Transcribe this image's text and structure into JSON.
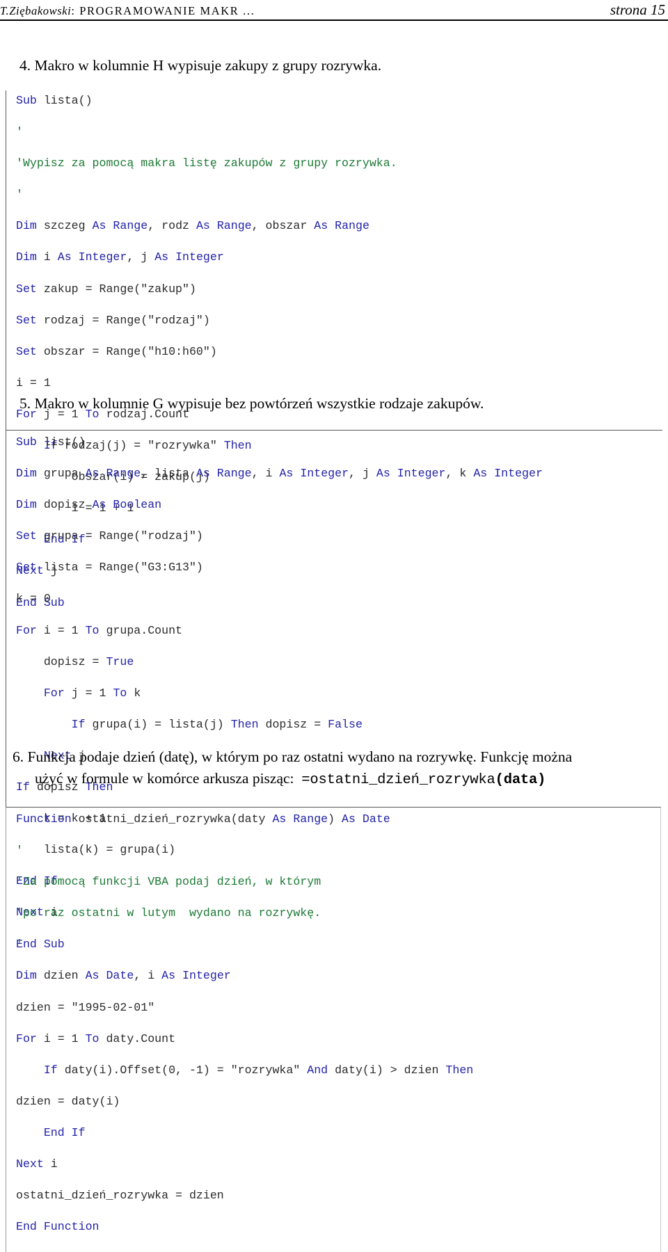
{
  "header": {
    "author": "T.Ziębakowski",
    "title": ": PROGRAMOWANIE MAKR ...",
    "page_label": "strona 15"
  },
  "tasks": [
    {
      "id": "task-4",
      "text": "4. Makro w kolumnie H wypisuje zakupy z grupy rozrywka."
    },
    {
      "id": "task-5",
      "text": "5. Makro w kolumnie G wypisuje bez powtórzeń wszystkie rodzaje zakupów."
    },
    {
      "id": "task-6",
      "line1": "6. Funkcja podaje dzień (datę), w którym po raz ostatni wydano na rozrywkę. Funkcję można",
      "line2_prefix": "użyć w formule w komórce arkusza pisząc:",
      "line2_formula_plain": "=ostatni_dzień_rozrywka",
      "line2_formula_bold": "(data)"
    }
  ],
  "code_blocks": {
    "block1": {
      "name": "lista-macro",
      "lines": [
        [
          {
            "t": "Sub ",
            "c": "kw"
          },
          {
            "t": "lista()",
            "c": "id"
          }
        ],
        [
          {
            "t": "'",
            "c": "cm"
          }
        ],
        [
          {
            "t": "'Wypisz za pomocą makra listę zakupów z grupy rozrywka.",
            "c": "cm"
          }
        ],
        [
          {
            "t": "'",
            "c": "cm"
          }
        ],
        [
          {
            "t": "Dim ",
            "c": "kw"
          },
          {
            "t": "szczeg ",
            "c": "id"
          },
          {
            "t": "As Range",
            "c": "kw"
          },
          {
            "t": ", rodz ",
            "c": "id"
          },
          {
            "t": "As Range",
            "c": "kw"
          },
          {
            "t": ", obszar ",
            "c": "id"
          },
          {
            "t": "As Range",
            "c": "kw"
          }
        ],
        [
          {
            "t": "Dim ",
            "c": "kw"
          },
          {
            "t": "i ",
            "c": "id"
          },
          {
            "t": "As Integer",
            "c": "kw"
          },
          {
            "t": ", j ",
            "c": "id"
          },
          {
            "t": "As Integer",
            "c": "kw"
          }
        ],
        [
          {
            "t": "Set ",
            "c": "kw"
          },
          {
            "t": "zakup = Range(\"zakup\")",
            "c": "id"
          }
        ],
        [
          {
            "t": "Set ",
            "c": "kw"
          },
          {
            "t": "rodzaj = Range(\"rodzaj\")",
            "c": "id"
          }
        ],
        [
          {
            "t": "Set ",
            "c": "kw"
          },
          {
            "t": "obszar = Range(\"h10:h60\")",
            "c": "id"
          }
        ],
        [
          {
            "t": "i = 1",
            "c": "id"
          }
        ],
        [
          {
            "t": "For ",
            "c": "kw"
          },
          {
            "t": "j = 1 ",
            "c": "id"
          },
          {
            "t": "To ",
            "c": "kw"
          },
          {
            "t": "rodzaj.Count",
            "c": "id"
          }
        ],
        [
          {
            "t": "    ",
            "c": "id"
          },
          {
            "t": "If ",
            "c": "kw"
          },
          {
            "t": "rodzaj(j) = \"rozrywka\" ",
            "c": "id"
          },
          {
            "t": "Then",
            "c": "kw"
          }
        ],
        [
          {
            "t": "        obszar(i) = zakup(j)",
            "c": "id"
          }
        ],
        [
          {
            "t": "        i = i + 1",
            "c": "id"
          }
        ],
        [
          {
            "t": "    ",
            "c": "id"
          },
          {
            "t": "End If",
            "c": "kw"
          }
        ],
        [
          {
            "t": "Next ",
            "c": "kw"
          },
          {
            "t": "j",
            "c": "id"
          }
        ],
        [
          {
            "t": "End Sub",
            "c": "kw"
          }
        ]
      ]
    },
    "block2": {
      "name": "list-macro",
      "lines": [
        [
          {
            "t": "Sub ",
            "c": "kw"
          },
          {
            "t": "list()",
            "c": "id"
          }
        ],
        [
          {
            "t": "Dim ",
            "c": "kw"
          },
          {
            "t": "grupa ",
            "c": "id"
          },
          {
            "t": "As Range",
            "c": "kw"
          },
          {
            "t": ", lista ",
            "c": "id"
          },
          {
            "t": "As Range",
            "c": "kw"
          },
          {
            "t": ", i ",
            "c": "id"
          },
          {
            "t": "As Integer",
            "c": "kw"
          },
          {
            "t": ", j ",
            "c": "id"
          },
          {
            "t": "As Integer",
            "c": "kw"
          },
          {
            "t": ", k ",
            "c": "id"
          },
          {
            "t": "As Integer",
            "c": "kw"
          }
        ],
        [
          {
            "t": "Dim ",
            "c": "kw"
          },
          {
            "t": "dopisz ",
            "c": "id"
          },
          {
            "t": "As Boolean",
            "c": "kw"
          }
        ],
        [
          {
            "t": "Set ",
            "c": "kw"
          },
          {
            "t": "grupa = Range(\"rodzaj\")",
            "c": "id"
          }
        ],
        [
          {
            "t": "Set ",
            "c": "kw"
          },
          {
            "t": "lista = Range(\"G3:G13\")",
            "c": "id"
          }
        ],
        [
          {
            "t": "k = 0",
            "c": "id"
          }
        ],
        [
          {
            "t": "For ",
            "c": "kw"
          },
          {
            "t": "i = 1 ",
            "c": "id"
          },
          {
            "t": "To ",
            "c": "kw"
          },
          {
            "t": "grupa.Count",
            "c": "id"
          }
        ],
        [
          {
            "t": "    dopisz = ",
            "c": "id"
          },
          {
            "t": "True",
            "c": "kw"
          }
        ],
        [
          {
            "t": "    ",
            "c": "id"
          },
          {
            "t": "For ",
            "c": "kw"
          },
          {
            "t": "j = 1 ",
            "c": "id"
          },
          {
            "t": "To ",
            "c": "kw"
          },
          {
            "t": "k",
            "c": "id"
          }
        ],
        [
          {
            "t": "        ",
            "c": "id"
          },
          {
            "t": "If ",
            "c": "kw"
          },
          {
            "t": "grupa(i) = lista(j) ",
            "c": "id"
          },
          {
            "t": "Then ",
            "c": "kw"
          },
          {
            "t": "dopisz = ",
            "c": "id"
          },
          {
            "t": "False",
            "c": "kw"
          }
        ],
        [
          {
            "t": "    ",
            "c": "id"
          },
          {
            "t": "Next ",
            "c": "kw"
          },
          {
            "t": "j",
            "c": "id"
          }
        ],
        [
          {
            "t": "If ",
            "c": "kw"
          },
          {
            "t": "dopisz ",
            "c": "id"
          },
          {
            "t": "Then",
            "c": "kw"
          }
        ],
        [
          {
            "t": "    k = k + 1",
            "c": "id"
          }
        ],
        [
          {
            "t": "    lista(k) = grupa(i)",
            "c": "id"
          }
        ],
        [
          {
            "t": "End If",
            "c": "kw"
          }
        ],
        [
          {
            "t": "Next ",
            "c": "kw"
          },
          {
            "t": "i",
            "c": "id"
          }
        ],
        [
          {
            "t": "End Sub",
            "c": "kw"
          }
        ]
      ]
    },
    "block3": {
      "name": "ostatni-dzien-rozrywka-function",
      "lines": [
        [
          {
            "t": "Function ",
            "c": "kw"
          },
          {
            "t": "ostatni_dzień_rozrywka(daty ",
            "c": "id"
          },
          {
            "t": "As Range",
            "c": "kw"
          },
          {
            "t": ") ",
            "c": "id"
          },
          {
            "t": "As Date",
            "c": "kw"
          }
        ],
        [
          {
            "t": "'",
            "c": "cm"
          }
        ],
        [
          {
            "t": "'Za pomocą funkcji VBA podaj dzień, w którym",
            "c": "cm"
          }
        ],
        [
          {
            "t": "'po raz ostatni w lutym  wydano na rozrywkę.",
            "c": "cm"
          }
        ],
        [
          {
            "t": "'",
            "c": "cm"
          }
        ],
        [
          {
            "t": "Dim ",
            "c": "kw"
          },
          {
            "t": "dzien ",
            "c": "id"
          },
          {
            "t": "As Date",
            "c": "kw"
          },
          {
            "t": ", i ",
            "c": "id"
          },
          {
            "t": "As Integer",
            "c": "kw"
          }
        ],
        [
          {
            "t": "dzien = \"1995-02-01\"",
            "c": "id"
          }
        ],
        [
          {
            "t": "For ",
            "c": "kw"
          },
          {
            "t": "i = 1 ",
            "c": "id"
          },
          {
            "t": "To ",
            "c": "kw"
          },
          {
            "t": "daty.Count",
            "c": "id"
          }
        ],
        [
          {
            "t": "    ",
            "c": "id"
          },
          {
            "t": "If ",
            "c": "kw"
          },
          {
            "t": "daty(i).Offset(0, -1) = \"rozrywka\" ",
            "c": "id"
          },
          {
            "t": "And ",
            "c": "kw"
          },
          {
            "t": "daty(i) > dzien ",
            "c": "id"
          },
          {
            "t": "Then",
            "c": "kw"
          }
        ],
        [
          {
            "t": "dzien = daty(i)",
            "c": "id"
          }
        ],
        [
          {
            "t": "    ",
            "c": "id"
          },
          {
            "t": "End If",
            "c": "kw"
          }
        ],
        [
          {
            "t": "Next ",
            "c": "kw"
          },
          {
            "t": "i",
            "c": "id"
          }
        ],
        [
          {
            "t": "ostatni_dzień_rozrywka = dzien",
            "c": "id"
          }
        ],
        [
          {
            "t": "End Function",
            "c": "kw"
          }
        ]
      ]
    }
  },
  "colors": {
    "keyword": "#2323a8",
    "comment": "#1d7a36",
    "identifier": "#2b2b2b",
    "rule": "#000000",
    "code_border": "#5a5a5a"
  }
}
